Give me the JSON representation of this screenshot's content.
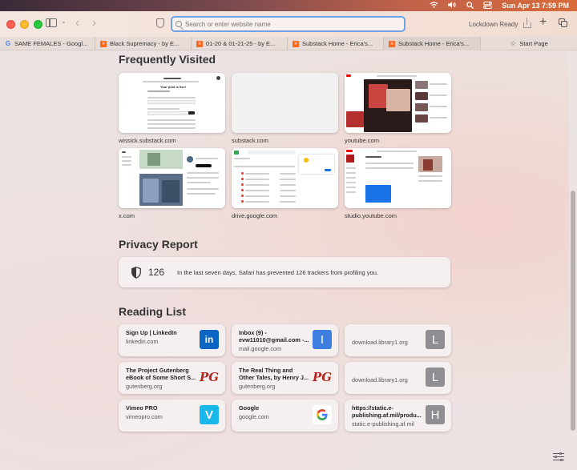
{
  "menubar": {
    "clock": "Sun Apr 13  7:59 PM"
  },
  "toolbar": {
    "address_placeholder": "Search or enter website name",
    "lockdown_label": "Lockdown Ready",
    "plus_label": "+"
  },
  "tabs": [
    {
      "label": "SAME FEMALES - Googl...",
      "favicon": "google"
    },
    {
      "label": "Black Supremacy - by E...",
      "favicon": "substack"
    },
    {
      "label": "01-20 & 01-21-25 - by E...",
      "favicon": "substack"
    },
    {
      "label": "Substack Home - Erica's...",
      "favicon": "substack"
    },
    {
      "label": "Substack Home - Erica's...",
      "favicon": "substack"
    },
    {
      "label": "Start Page",
      "favicon": "star"
    }
  ],
  "frequently_visited": {
    "title": "Frequently Visited",
    "items": [
      {
        "label": "wissick.substack.com"
      },
      {
        "label": "substack.com"
      },
      {
        "label": "youtube.com"
      },
      {
        "label": "x.com"
      },
      {
        "label": "drive.google.com"
      },
      {
        "label": "studio.youtube.com"
      }
    ],
    "wissick_preview_text": "Your post is live!"
  },
  "privacy_report": {
    "title": "Privacy Report",
    "count": "126",
    "text": "In the last seven days, Safari has prevented 126 trackers from profiling you."
  },
  "reading_list": {
    "title": "Reading List",
    "items": [
      {
        "title": "Sign Up | LinkedIn",
        "domain": "linkedin.com",
        "icon": "in",
        "icon_type": "linkedin"
      },
      {
        "title": "Inbox (9) - evw11010@gmail.com -...",
        "domain": "mail.google.com",
        "icon": "I",
        "icon_type": "letter-blue"
      },
      {
        "title": "",
        "domain": "download.library1.org",
        "icon": "L",
        "icon_type": "letter-gray"
      },
      {
        "title": "The Project Gutenberg eBook of Some Short S...",
        "domain": "gutenberg.org",
        "icon": "PG",
        "icon_type": "pg"
      },
      {
        "title": "The Real Thing and Other Tales, by Henry J...",
        "domain": "gutenberg.org",
        "icon": "PG",
        "icon_type": "pg"
      },
      {
        "title": "",
        "domain": "download.library1.org",
        "icon": "L",
        "icon_type": "letter-gray"
      },
      {
        "title": "Vimeo PRO",
        "domain": "vimeopro.com",
        "icon": "V",
        "icon_type": "vimeo"
      },
      {
        "title": "Google",
        "domain": "google.com",
        "icon": "G",
        "icon_type": "google"
      },
      {
        "title": "https://static.e-publishing.af.mil/produ...",
        "domain": "static.e-publishing.af.mil",
        "icon": "H",
        "icon_type": "letter-gray"
      }
    ]
  },
  "colors": {
    "accent": "#6ea2e6",
    "substack": "#ff6719",
    "linkedin": "#0a66c2",
    "vimeo": "#1ab7ea",
    "gutenberg": "#b3261e"
  }
}
